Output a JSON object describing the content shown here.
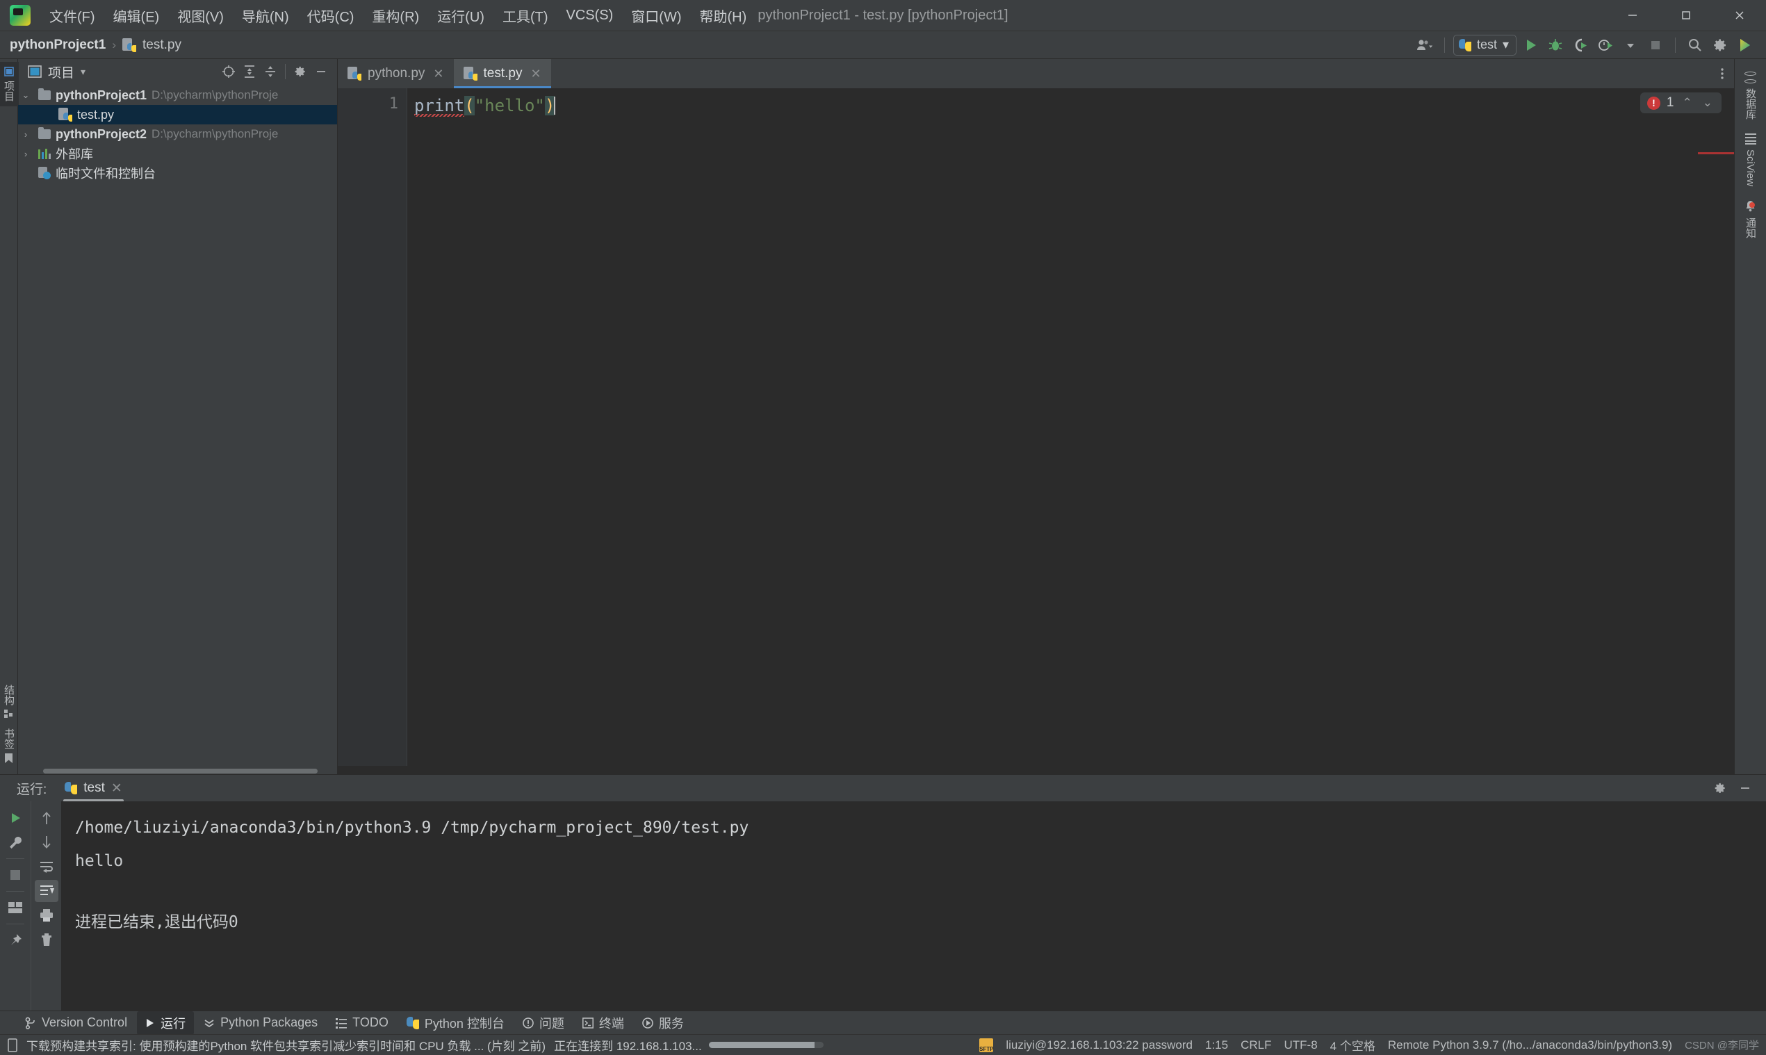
{
  "titlebar": {
    "app_icon": "pycharm-logo-icon",
    "window_title": "pythonProject1 - test.py [pythonProject1]",
    "menus": [
      {
        "label": "文件(F)"
      },
      {
        "label": "编辑(E)"
      },
      {
        "label": "视图(V)"
      },
      {
        "label": "导航(N)"
      },
      {
        "label": "代码(C)"
      },
      {
        "label": "重构(R)"
      },
      {
        "label": "运行(U)"
      },
      {
        "label": "工具(T)"
      },
      {
        "label": "VCS(S)"
      },
      {
        "label": "窗口(W)"
      },
      {
        "label": "帮助(H)"
      }
    ],
    "window_controls": {
      "minimize": "—",
      "maximize": "☐",
      "close": "✕"
    }
  },
  "toolbar": {
    "breadcrumb": {
      "project": "pythonProject1",
      "separator": "›",
      "file": "test.py"
    },
    "run_config": {
      "name": "test",
      "caret": "▾"
    },
    "buttons": [
      {
        "name": "user-account-button",
        "label": ""
      },
      {
        "name": "run-button",
        "label": ""
      },
      {
        "name": "debug-button",
        "label": ""
      },
      {
        "name": "run-with-coverage-button",
        "label": ""
      },
      {
        "name": "profile-button",
        "label": ""
      },
      {
        "name": "stop-button",
        "label": ""
      },
      {
        "name": "search-everywhere-button",
        "label": ""
      },
      {
        "name": "settings-button",
        "label": ""
      }
    ]
  },
  "left_rail": {
    "top": [
      {
        "label": "项目",
        "icon": "project-icon"
      }
    ],
    "bottom": [
      {
        "label": "结构",
        "icon": "structure-icon"
      },
      {
        "label": "书签",
        "icon": "bookmark-icon"
      }
    ]
  },
  "project_panel": {
    "title": "项目",
    "caret": "▾",
    "tools": [
      "select-opened-file-icon",
      "expand-all-icon",
      "collapse-all-icon",
      "settings-gear-icon",
      "hide-icon"
    ],
    "tree": [
      {
        "indent": 0,
        "twisty": "⌄",
        "icon": "folder-icon",
        "label": "pythonProject1",
        "bold": true,
        "path": "D:\\pycharm\\pythonProje",
        "selected": false
      },
      {
        "indent": 1,
        "twisty": "",
        "icon": "python-file-icon",
        "label": "test.py",
        "bold": false,
        "path": "",
        "selected": true
      },
      {
        "indent": 0,
        "twisty": "›",
        "icon": "folder-icon",
        "label": "pythonProject2",
        "bold": true,
        "path": "D:\\pycharm\\pythonProje",
        "selected": false
      },
      {
        "indent": 0,
        "twisty": "›",
        "icon": "external-libraries-icon",
        "label": "外部库",
        "bold": false,
        "path": "",
        "selected": false
      },
      {
        "indent": 0,
        "twisty": "",
        "icon": "scratches-icon",
        "label": "临时文件和控制台",
        "bold": false,
        "path": "",
        "selected": false
      }
    ]
  },
  "editor": {
    "tabs": [
      {
        "label": "python.py",
        "active": false,
        "close": "✕"
      },
      {
        "label": "test.py",
        "active": true,
        "close": "✕"
      }
    ],
    "line_numbers": [
      "1"
    ],
    "code": {
      "fn": "print",
      "open_paren": "(",
      "string": "\"hello\"",
      "close_paren": ")"
    },
    "error_badge": {
      "count": "1",
      "icon": "error-icon",
      "up": "⌃",
      "down": "⌄"
    }
  },
  "right_rail": [
    {
      "label": "数据库",
      "icon": "database-icon"
    },
    {
      "label": "SciView",
      "icon": "sciview-grid-icon"
    },
    {
      "label": "通知",
      "icon": "notifications-bell-icon",
      "badge": true
    }
  ],
  "run_panel": {
    "label": "运行:",
    "tab": {
      "label": "test",
      "close": "✕"
    },
    "header_buttons": [
      "settings-gear-icon",
      "hide-icon"
    ],
    "left_tools": [
      "rerun-icon",
      "wrench-icon",
      "stop-icon",
      "layout-icon",
      "pin-icon"
    ],
    "second_tools": [
      "up-arrow-icon",
      "down-arrow-icon",
      "soft-wrap-icon",
      "scroll-to-end-icon",
      "print-icon",
      "clear-all-icon"
    ],
    "console": {
      "command": "/home/liuziyi/anaconda3/bin/python3.9 /tmp/pycharm_project_890/test.py",
      "output": "hello",
      "exit": "进程已结束,退出代码0"
    }
  },
  "bottom_bar": [
    {
      "label": "Version Control",
      "icon": "version-control-icon",
      "active": false
    },
    {
      "label": "运行",
      "icon": "run-icon",
      "active": true
    },
    {
      "label": "Python Packages",
      "icon": "packages-icon",
      "active": false
    },
    {
      "label": "TODO",
      "icon": "todo-icon",
      "active": false
    },
    {
      "label": "Python 控制台",
      "icon": "python-console-icon",
      "active": false
    },
    {
      "label": "问题",
      "icon": "problems-icon",
      "active": false
    },
    {
      "label": "终端",
      "icon": "terminal-icon",
      "active": false
    },
    {
      "label": "服务",
      "icon": "services-icon",
      "active": false
    }
  ],
  "status_bar": {
    "left_icon": "indexing-icon",
    "message": "下载预构建共享索引: 使用预构建的Python 软件包共享索引减少索引时间和 CPU 负载 ... (片刻 之前)",
    "progress_text": "正在连接到 192.168.1.103...",
    "right": {
      "sftp_label": "SFTP",
      "connection": "liuziyi@192.168.1.103:22 password",
      "caret_position": "1:15",
      "line_separator": "CRLF",
      "encoding": "UTF-8",
      "indent": "4 个空格",
      "interpreter": "Remote Python 3.9.7 (/ho.../anaconda3/bin/python3.9)",
      "watermark": "CSDN @李同学"
    }
  },
  "colors": {
    "bg": "#3c3f41",
    "editor_bg": "#2b2b2b",
    "selection": "#0d293e",
    "accent": "#4a88c7",
    "error": "#cc3a3a",
    "string": "#6a8759",
    "paren": "#ffc66d"
  }
}
